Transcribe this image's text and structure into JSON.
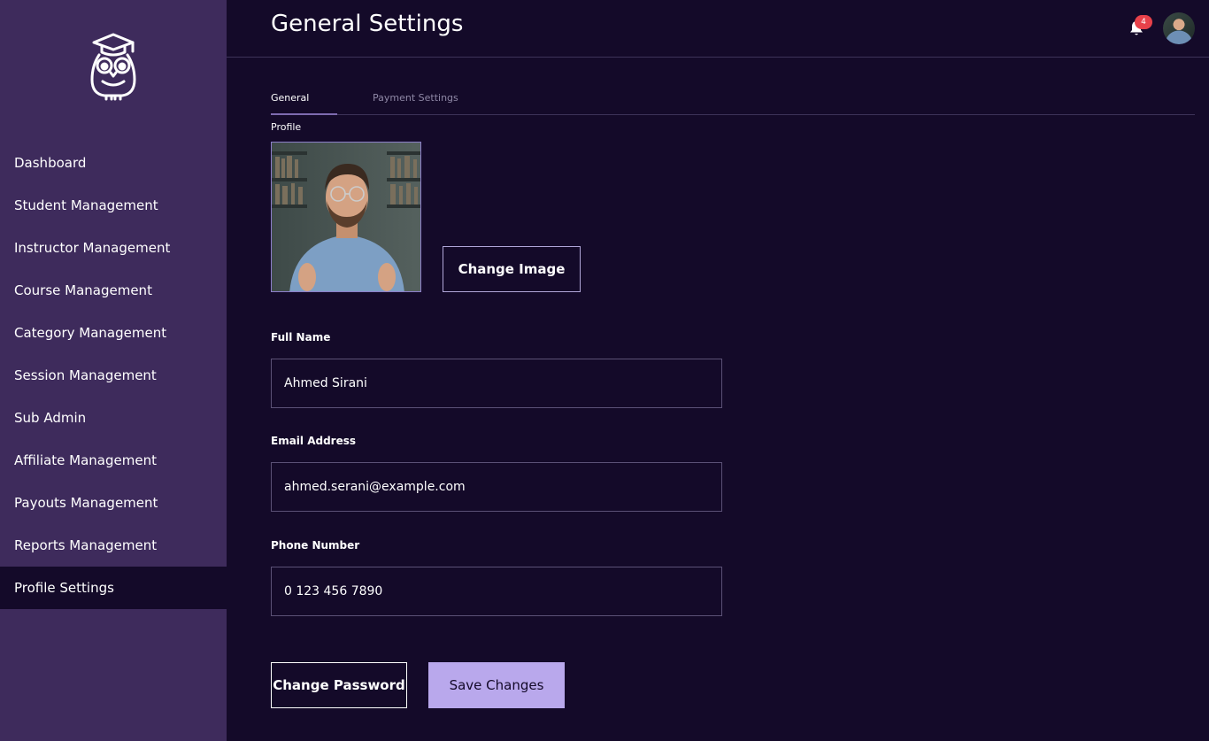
{
  "sidebar": {
    "items": [
      {
        "label": "Dashboard"
      },
      {
        "label": "Student Management"
      },
      {
        "label": "Instructor Management"
      },
      {
        "label": "Course Management"
      },
      {
        "label": "Category Management"
      },
      {
        "label": "Session Management"
      },
      {
        "label": "Sub Admin"
      },
      {
        "label": "Affiliate Management"
      },
      {
        "label": "Payouts Management"
      },
      {
        "label": "Reports Management"
      },
      {
        "label": "Profile Settings"
      }
    ],
    "active_item": "Profile Settings"
  },
  "header": {
    "title": "General Settings",
    "notification_count": "4"
  },
  "tabs": [
    {
      "label": "General Profile",
      "active": true
    },
    {
      "label": "Payment Settings",
      "active": false
    }
  ],
  "profile": {
    "change_image_label": "Change Image"
  },
  "form": {
    "full_name": {
      "label": "Full Name",
      "value": "Ahmed Sirani"
    },
    "email": {
      "label": "Email Address",
      "value": "ahmed.serani@example.com"
    },
    "phone": {
      "label": "Phone Number",
      "value": "0 123 456 7890"
    }
  },
  "actions": {
    "change_password_label": "Change Password",
    "save_changes_label": "Save Changes"
  },
  "colors": {
    "background": "#140a29",
    "sidebar": "#3e2b5c",
    "accent": "#b9a8ec",
    "badge": "#e8414a"
  }
}
